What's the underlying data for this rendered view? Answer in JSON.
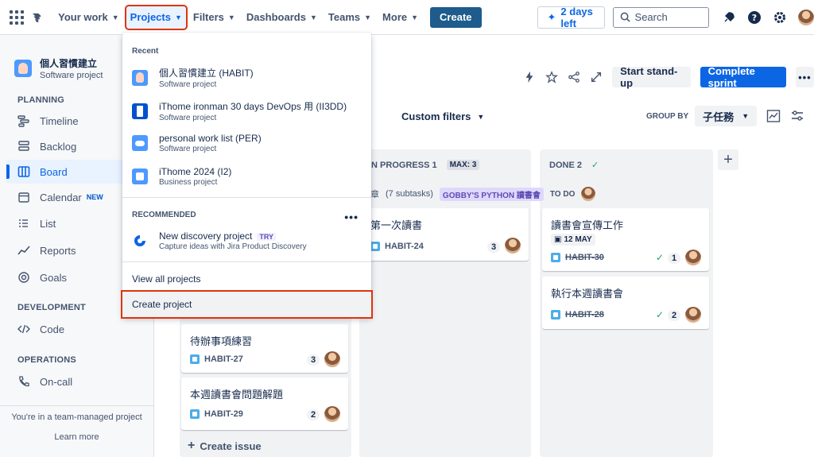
{
  "topnav": {
    "your_work": "Your work",
    "projects": "Projects",
    "filters": "Filters",
    "dashboards": "Dashboards",
    "teams": "Teams",
    "more": "More",
    "create": "Create",
    "trial": "2 days left",
    "search_placeholder": "Search"
  },
  "sidebar": {
    "project_name": "個人習慣建立",
    "project_type": "Software project",
    "planning": "PLANNING",
    "development": "DEVELOPMENT",
    "operations": "OPERATIONS",
    "items": {
      "timeline": "Timeline",
      "backlog": "Backlog",
      "board": "Board",
      "calendar": "Calendar",
      "calendar_badge": "NEW",
      "list": "List",
      "reports": "Reports",
      "goals": "Goals",
      "code": "Code",
      "oncall": "On-call"
    },
    "footer_text": "You're in a team-managed project",
    "learn_more": "Learn more"
  },
  "toolbar": {
    "standup": "Start stand-up",
    "complete": "Complete sprint",
    "custom_filters": "Custom filters",
    "group_by": "GROUP BY",
    "group_by_value": "子任務"
  },
  "board": {
    "in_progress": {
      "label": "IN PROGRESS 1",
      "max": "MAX: 3"
    },
    "done": {
      "label": "DONE 2"
    },
    "swimlane": {
      "title": "章",
      "subtasks": "(7 subtasks)",
      "label": "GOBBY'S PYTHON 讀書會",
      "status": "TO DO"
    },
    "todo_cards": [
      {
        "title": "待辦事項練習",
        "key": "HABIT-27",
        "count": "3"
      },
      {
        "title": "本週讀書會問題解題",
        "key": "HABIT-29",
        "count": "2"
      }
    ],
    "progress_card": {
      "title": "第一次讀書",
      "key": "HABIT-24",
      "count": "3"
    },
    "done_cards": [
      {
        "title": "讀書會宣傳工作",
        "date": "12 MAY",
        "key": "HABIT-30",
        "count": "1"
      },
      {
        "title": "執行本週讀書會",
        "key": "HABIT-28",
        "count": "2"
      }
    ],
    "create_issue": "Create issue"
  },
  "dropdown": {
    "recent": "Recent",
    "recommended": "RECOMMENDED",
    "projects": [
      {
        "name": "個人習慣建立 (HABIT)",
        "type": "Software project"
      },
      {
        "name": "iThome ironman 30 days DevOps 用 (II3DD)",
        "type": "Software project"
      },
      {
        "name": "personal work list (PER)",
        "type": "Software project"
      },
      {
        "name": "iThome 2024 (I2)",
        "type": "Business project"
      }
    ],
    "recommended_item": {
      "name": "New discovery project",
      "badge": "TRY",
      "desc": "Capture ideas with Jira Product Discovery"
    },
    "view_all": "View all projects",
    "create_project": "Create project"
  }
}
